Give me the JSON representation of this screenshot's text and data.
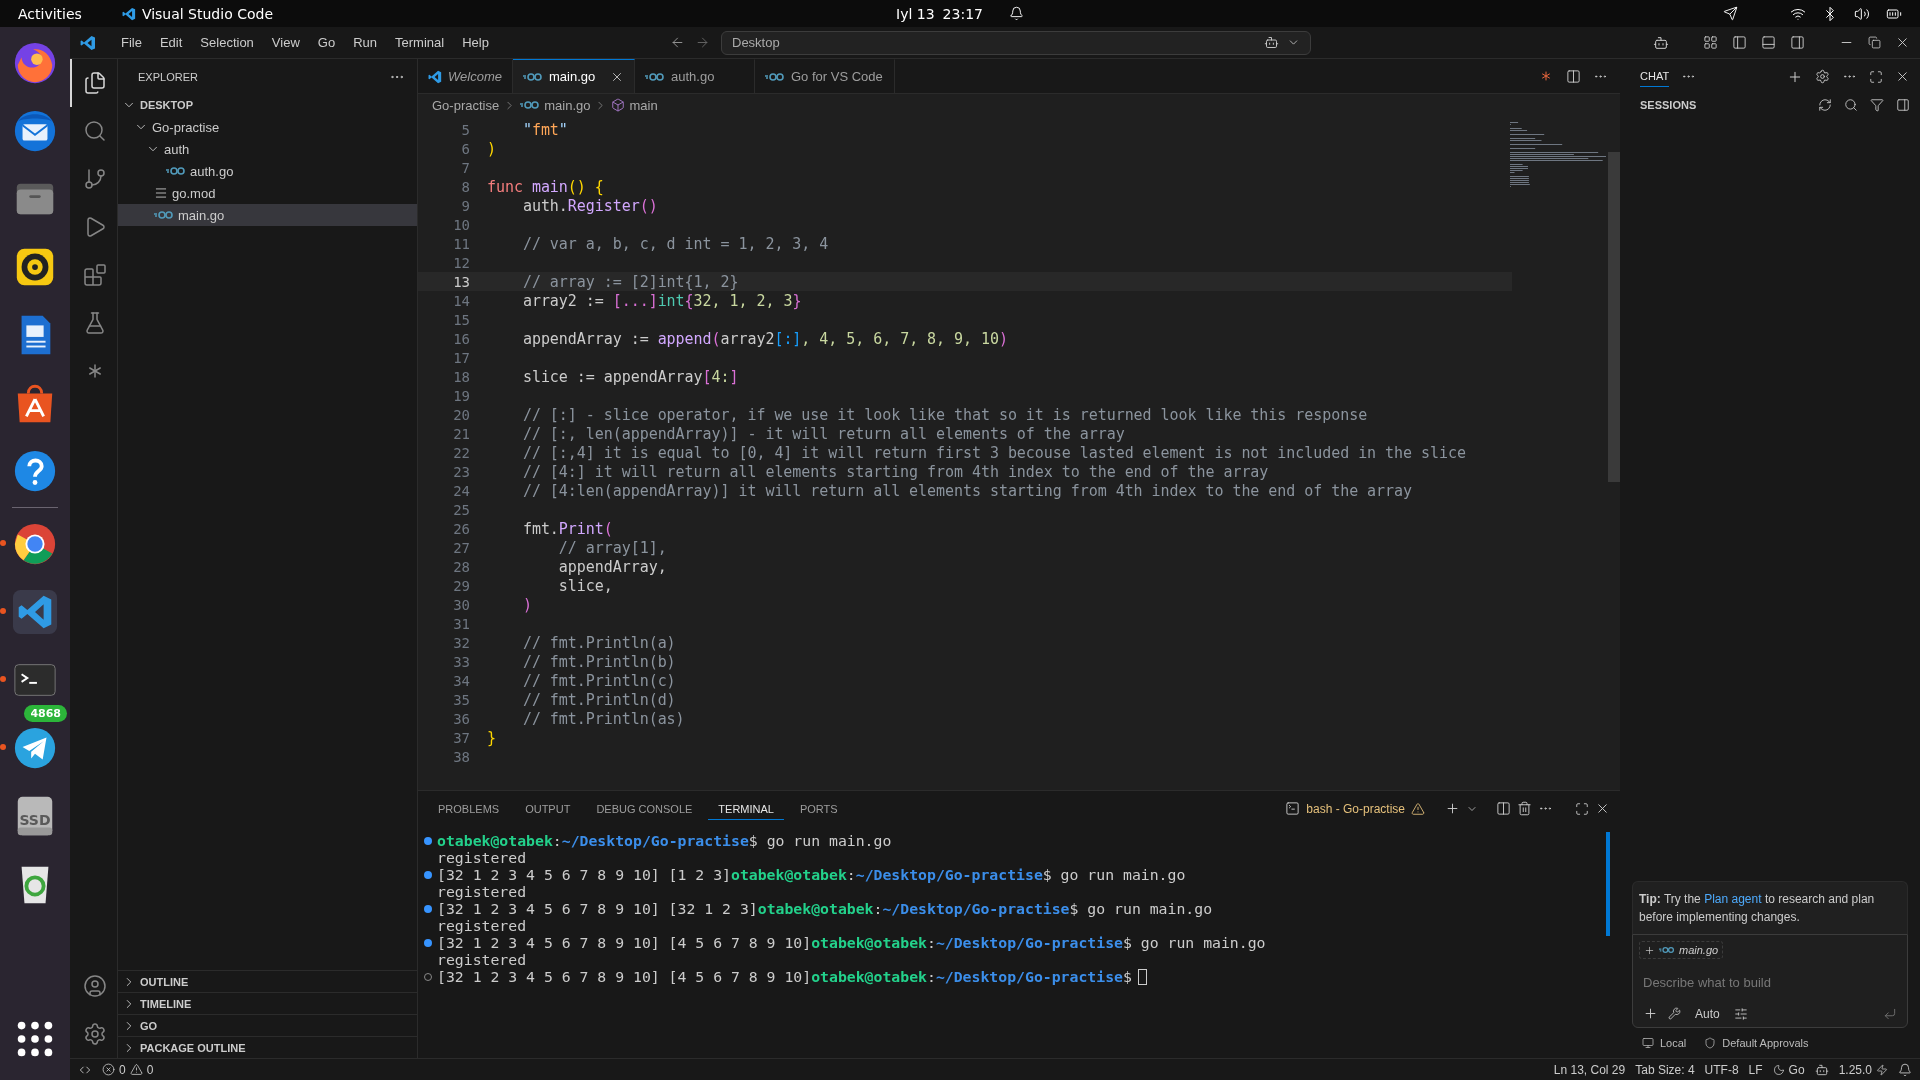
{
  "top_bar": {
    "activities": "Activities",
    "app": "Visual Studio Code",
    "date": "Iyl 13",
    "time": "23:17"
  },
  "dock": {
    "items": [
      {
        "kind": "browser-fox",
        "running": false
      },
      {
        "kind": "mail",
        "running": false
      },
      {
        "kind": "files",
        "running": false
      },
      {
        "kind": "speaker",
        "running": false
      },
      {
        "kind": "document",
        "running": false
      },
      {
        "kind": "store",
        "running": false
      },
      {
        "kind": "help",
        "running": false
      },
      {
        "kind": "separator"
      },
      {
        "kind": "browser-ring",
        "running": true
      },
      {
        "kind": "code",
        "running": true
      },
      {
        "kind": "terminal",
        "running": true
      },
      {
        "kind": "plane",
        "running": true,
        "badge": "4868"
      },
      {
        "kind": "drive",
        "running": false,
        "label": "SSD"
      },
      {
        "kind": "recycle",
        "running": false
      }
    ]
  },
  "menu": [
    "File",
    "Edit",
    "Selection",
    "View",
    "Go",
    "Run",
    "Terminal",
    "Help"
  ],
  "command_center": "Desktop",
  "activity_bar": [
    {
      "kind": "files",
      "selected": true
    },
    {
      "kind": "search",
      "selected": false
    },
    {
      "kind": "branch",
      "selected": false
    },
    {
      "kind": "run",
      "selected": false
    },
    {
      "kind": "extensions",
      "selected": false
    },
    {
      "kind": "flask",
      "selected": false
    },
    {
      "kind": "spark",
      "selected": false
    }
  ],
  "sidebar": {
    "title": "EXPLORER",
    "tree": [
      {
        "label": "DESKTOP",
        "kind": "root",
        "expanded": true,
        "selected": false,
        "children": [
          {
            "label": "Go-practise",
            "kind": "folder",
            "expanded": true,
            "selected": false,
            "children": [
              {
                "label": "auth",
                "kind": "folder",
                "expanded": true,
                "selected": false,
                "children": [
                  {
                    "label": "auth.go",
                    "kind": "go",
                    "selected": false
                  }
                ]
              },
              {
                "label": "go.mod",
                "kind": "mod",
                "selected": false
              },
              {
                "label": "main.go",
                "kind": "go",
                "selected": true
              }
            ]
          }
        ]
      }
    ],
    "sections": [
      {
        "label": "OUTLINE",
        "expanded": false
      },
      {
        "label": "TIMELINE",
        "expanded": false
      },
      {
        "label": "GO",
        "expanded": false
      },
      {
        "label": "PACKAGE OUTLINE",
        "expanded": false
      }
    ]
  },
  "tabs": [
    {
      "label": "Welcome",
      "kind": "vscode",
      "preview": true,
      "selected": false
    },
    {
      "label": "main.go",
      "kind": "go",
      "preview": false,
      "selected": true
    },
    {
      "label": "auth.go",
      "kind": "go",
      "preview": false,
      "selected": false
    },
    {
      "label": "Go for VS Code",
      "kind": "go",
      "preview": false,
      "selected": false
    }
  ],
  "breadcrumbs": [
    {
      "label": "Go-practise",
      "kind": "folder"
    },
    {
      "label": "main.go",
      "kind": "go"
    },
    {
      "label": "main",
      "kind": "symbol"
    }
  ],
  "code": [
    {
      "n": "5",
      "selected": false,
      "tokens": [
        {
          "text": "    \"",
          "kind": "string"
        },
        {
          "text": "fmt",
          "kind": "package"
        },
        {
          "text": "\"",
          "kind": "string"
        }
      ]
    },
    {
      "n": "6",
      "selected": false,
      "tokens": [
        {
          "text": ")",
          "kind": "bracket1"
        }
      ]
    },
    {
      "n": "7",
      "selected": false
    },
    {
      "n": "8",
      "selected": false,
      "tokens": [
        {
          "text": "func ",
          "kind": "keyword"
        },
        {
          "text": "main",
          "kind": "func"
        },
        {
          "text": "() {",
          "kind": "bracket1"
        }
      ]
    },
    {
      "n": "9",
      "selected": false,
      "tokens": [
        {
          "text": "    auth.",
          "kind": "plain"
        },
        {
          "text": "Register",
          "kind": "func"
        },
        {
          "text": "()",
          "kind": "bracket2"
        }
      ]
    },
    {
      "n": "10",
      "selected": false
    },
    {
      "n": "11",
      "selected": false,
      "tokens": [
        {
          "text": "    // var a, b, c, d int = 1, 2, 3, 4",
          "kind": "comment"
        }
      ]
    },
    {
      "n": "12",
      "selected": false
    },
    {
      "n": "13",
      "selected": true,
      "tokens": [
        {
          "text": "    // array := [2]int{1, 2}",
          "kind": "comment"
        }
      ]
    },
    {
      "n": "14",
      "selected": false,
      "tokens": [
        {
          "text": "    array2 := ",
          "kind": "plain"
        },
        {
          "text": "[...]",
          "kind": "bracket2"
        },
        {
          "text": "int",
          "kind": "type"
        },
        {
          "text": "{",
          "kind": "bracket2"
        },
        {
          "text": "32, 1, 2, 3",
          "kind": "number"
        },
        {
          "text": "}",
          "kind": "bracket2"
        }
      ]
    },
    {
      "n": "15",
      "selected": false
    },
    {
      "n": "16",
      "selected": false,
      "tokens": [
        {
          "text": "    appendArray := ",
          "kind": "plain"
        },
        {
          "text": "append",
          "kind": "func"
        },
        {
          "text": "(",
          "kind": "bracket2"
        },
        {
          "text": "array2",
          "kind": "plain"
        },
        {
          "text": "[:]",
          "kind": "bracket3"
        },
        {
          "text": ", 4, 5, 6, 7, 8, 9, 10",
          "kind": "number"
        },
        {
          "text": ")",
          "kind": "bracket2"
        }
      ]
    },
    {
      "n": "17",
      "selected": false
    },
    {
      "n": "18",
      "selected": false,
      "tokens": [
        {
          "text": "    slice := appendArray",
          "kind": "plain"
        },
        {
          "text": "[",
          "kind": "bracket2"
        },
        {
          "text": "4:",
          "kind": "number"
        },
        {
          "text": "]",
          "kind": "bracket2"
        }
      ]
    },
    {
      "n": "19",
      "selected": false
    },
    {
      "n": "20",
      "selected": false,
      "tokens": [
        {
          "text": "    // [:] - slice operator, if we use it look like that so it is returned look like this response",
          "kind": "comment"
        }
      ]
    },
    {
      "n": "21",
      "selected": false,
      "tokens": [
        {
          "text": "    // [:, len(appendArray)] - it will return all elements of the array",
          "kind": "comment"
        }
      ]
    },
    {
      "n": "22",
      "selected": false,
      "tokens": [
        {
          "text": "    // [:,4] it is equal to [0, 4] it will return first 3 becouse lasted element is not included in the slice",
          "kind": "comment"
        }
      ]
    },
    {
      "n": "23",
      "selected": false,
      "tokens": [
        {
          "text": "    // [4:] it will return all elements starting from 4th index to the end of the array",
          "kind": "comment"
        }
      ]
    },
    {
      "n": "24",
      "selected": false,
      "tokens": [
        {
          "text": "    // [4:len(appendArray)] it will return all elements starting from 4th index to the end of the array",
          "kind": "comment"
        }
      ]
    },
    {
      "n": "25",
      "selected": false
    },
    {
      "n": "26",
      "selected": false,
      "tokens": [
        {
          "text": "    fmt.",
          "kind": "plain"
        },
        {
          "text": "Print",
          "kind": "func"
        },
        {
          "text": "(",
          "kind": "bracket2"
        }
      ]
    },
    {
      "n": "27",
      "selected": false,
      "tokens": [
        {
          "text": "        // array[1],",
          "kind": "comment"
        }
      ]
    },
    {
      "n": "28",
      "selected": false,
      "tokens": [
        {
          "text": "        appendArray,",
          "kind": "plain"
        }
      ]
    },
    {
      "n": "29",
      "selected": false,
      "tokens": [
        {
          "text": "        slice,",
          "kind": "plain"
        }
      ]
    },
    {
      "n": "30",
      "selected": false,
      "tokens": [
        {
          "text": "    )",
          "kind": "bracket2"
        }
      ]
    },
    {
      "n": "31",
      "selected": false
    },
    {
      "n": "32",
      "selected": false,
      "tokens": [
        {
          "text": "    // fmt.Println(a)",
          "kind": "comment"
        }
      ]
    },
    {
      "n": "33",
      "selected": false,
      "tokens": [
        {
          "text": "    // fmt.Println(b)",
          "kind": "comment"
        }
      ]
    },
    {
      "n": "34",
      "selected": false,
      "tokens": [
        {
          "text": "    // fmt.Println(c)",
          "kind": "comment"
        }
      ]
    },
    {
      "n": "35",
      "selected": false,
      "tokens": [
        {
          "text": "    // fmt.Println(d)",
          "kind": "comment"
        }
      ]
    },
    {
      "n": "36",
      "selected": false,
      "tokens": [
        {
          "text": "    // fmt.Println(as)",
          "kind": "comment"
        }
      ]
    },
    {
      "n": "37",
      "selected": false,
      "tokens": [
        {
          "text": "}",
          "kind": "bracket1"
        }
      ]
    },
    {
      "n": "38",
      "selected": false
    }
  ],
  "panel": {
    "tabs": [
      {
        "label": "PROBLEMS",
        "selected": false
      },
      {
        "label": "OUTPUT",
        "selected": false
      },
      {
        "label": "DEBUG CONSOLE",
        "selected": false
      },
      {
        "label": "TERMINAL",
        "selected": true
      },
      {
        "label": "PORTS",
        "selected": false
      }
    ],
    "terminal_name": "bash - Go-practise",
    "lines": [
      {
        "kind": "command",
        "cursor": false,
        "segs": [
          {
            "text": "otabek@otabek",
            "kind": "user"
          },
          {
            "text": ":",
            "kind": "plain"
          },
          {
            "text": "~/Desktop/Go-practise",
            "kind": "path"
          },
          {
            "text": "$ go run main.go",
            "kind": "plain"
          }
        ]
      },
      {
        "kind": "output",
        "cursor": false,
        "segs": [
          {
            "text": "registered",
            "kind": "plain"
          }
        ]
      },
      {
        "kind": "command",
        "cursor": false,
        "segs": [
          {
            "text": "[32 1 2 3 4 5 6 7 8 9 10] [1 2 3]",
            "kind": "plain"
          },
          {
            "text": "otabek@otabek",
            "kind": "user"
          },
          {
            "text": ":",
            "kind": "plain"
          },
          {
            "text": "~/Desktop/Go-practise",
            "kind": "path"
          },
          {
            "text": "$ go run main.go",
            "kind": "plain"
          }
        ]
      },
      {
        "kind": "output",
        "cursor": false,
        "segs": [
          {
            "text": "registered",
            "kind": "plain"
          }
        ]
      },
      {
        "kind": "command",
        "cursor": false,
        "segs": [
          {
            "text": "[32 1 2 3 4 5 6 7 8 9 10] [32 1 2 3]",
            "kind": "plain"
          },
          {
            "text": "otabek@otabek",
            "kind": "user"
          },
          {
            "text": ":",
            "kind": "plain"
          },
          {
            "text": "~/Desktop/Go-practise",
            "kind": "path"
          },
          {
            "text": "$ go run main.go",
            "kind": "plain"
          }
        ]
      },
      {
        "kind": "output",
        "cursor": false,
        "segs": [
          {
            "text": "registered",
            "kind": "plain"
          }
        ]
      },
      {
        "kind": "command",
        "cursor": false,
        "segs": [
          {
            "text": "[32 1 2 3 4 5 6 7 8 9 10] [4 5 6 7 8 9 10]",
            "kind": "plain"
          },
          {
            "text": "otabek@otabek",
            "kind": "user"
          },
          {
            "text": ":",
            "kind": "plain"
          },
          {
            "text": "~/Desktop/Go-practise",
            "kind": "path"
          },
          {
            "text": "$ go run main.go",
            "kind": "plain"
          }
        ]
      },
      {
        "kind": "output",
        "cursor": false,
        "segs": [
          {
            "text": "registered",
            "kind": "plain"
          }
        ]
      },
      {
        "kind": "prompt",
        "cursor": true,
        "segs": [
          {
            "text": "[32 1 2 3 4 5 6 7 8 9 10] [4 5 6 7 8 9 10]",
            "kind": "plain"
          },
          {
            "text": "otabek@otabek",
            "kind": "user"
          },
          {
            "text": ":",
            "kind": "plain"
          },
          {
            "text": "~/Desktop/Go-practise",
            "kind": "path"
          },
          {
            "text": "$",
            "kind": "plain"
          }
        ]
      }
    ]
  },
  "chat": {
    "title": "CHAT",
    "sessions": "SESSIONS",
    "tip": {
      "prefix": "**Tip:** Try the",
      "link": "Plan agent",
      "suffix": "to research and plan before implementing changes."
    },
    "attachment": "main.go",
    "placeholder": "Describe what to build",
    "mode": "Auto",
    "location": "Local",
    "approvals": "Default Approvals"
  },
  "status_bar": {
    "errors": "0",
    "warnings": "0",
    "position": "Ln 13, Col 29",
    "tab_size": "Tab Size: 4",
    "encoding": "UTF-8",
    "eol": "LF",
    "language": "Go",
    "version": "1.25.0"
  }
}
